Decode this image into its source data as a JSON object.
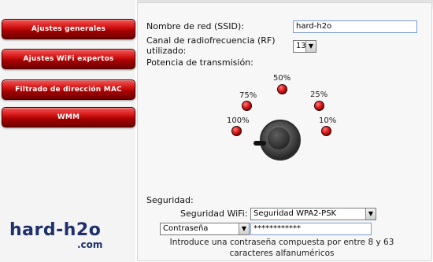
{
  "nav": {
    "items": [
      {
        "label": "Ajustes generales"
      },
      {
        "label": "Ajustes WiFi expertos"
      },
      {
        "label": "Filtrado de dirección MAC"
      },
      {
        "label": "WMM"
      }
    ]
  },
  "logo": {
    "text": "hard-h2o",
    "suffix": ".com"
  },
  "form": {
    "ssid_label": "Nombre de red (SSID):",
    "ssid_value": "hard-h2o",
    "channel_label": "Canal de radiofrecuencia (RF) utilizado:",
    "channel_value": "13",
    "power_label": "Potencia de transmisión:",
    "power_levels": [
      "100%",
      "75%",
      "50%",
      "25%",
      "10%"
    ],
    "security_section_label": "Seguridad:",
    "security_wifi_label": "Seguridad WiFi:",
    "security_wifi_value": "Seguridad WPA2-PSK",
    "key_type_value": "Contraseña",
    "password_value": "************",
    "hint_text": "Introduce una contraseña compuesta por entre 8 y 63 caracteres alfanuméricos"
  },
  "icons": {
    "dropdown": "chevron-down-icon"
  }
}
